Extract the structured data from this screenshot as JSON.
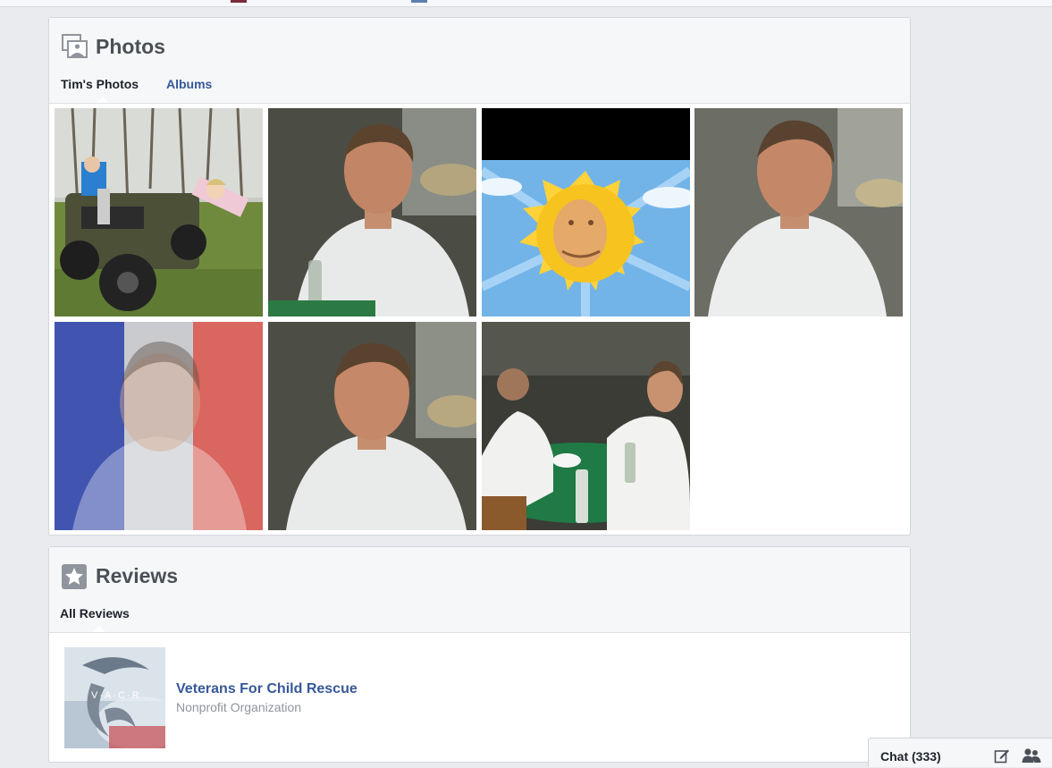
{
  "photos_section": {
    "title": "Photos",
    "tabs": [
      {
        "label": "Tim's Photos",
        "active": true
      },
      {
        "label": "Albums",
        "active": false
      }
    ],
    "thumbnails": [
      {
        "subject": "children on ATV"
      },
      {
        "subject": "man smiling"
      },
      {
        "subject": "sun face"
      },
      {
        "subject": "man smiling"
      },
      {
        "subject": "man with French flag overlay"
      },
      {
        "subject": "man smiling"
      },
      {
        "subject": "two men at table"
      }
    ]
  },
  "reviews_section": {
    "title": "Reviews",
    "tabs": [
      {
        "label": "All Reviews",
        "active": true
      }
    ],
    "items": [
      {
        "name": "Veterans For Child Rescue",
        "category": "Nonprofit Organization",
        "logo_text": "V·A·C·R"
      }
    ]
  },
  "chat": {
    "label": "Chat (333)"
  },
  "colors": {
    "link": "#365899",
    "background": "#e9ebee",
    "header": "#f6f7f9"
  }
}
